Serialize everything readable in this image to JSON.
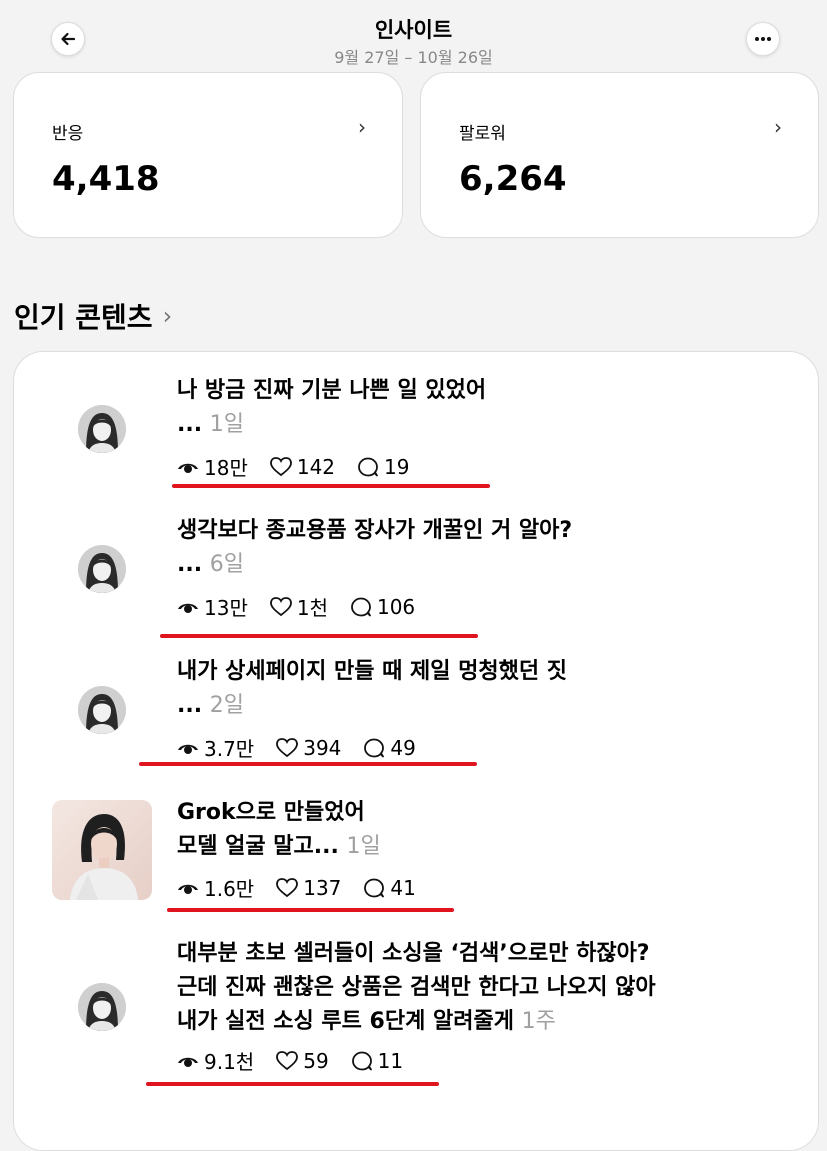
{
  "header": {
    "title": "인사이트",
    "date_range": "9월 27일 – 10월 26일"
  },
  "stats": [
    {
      "label": "반응",
      "value": "4,418"
    },
    {
      "label": "팔로워",
      "value": "6,264"
    }
  ],
  "section": {
    "title": "인기 콘텐츠",
    "chevron": "›"
  },
  "posts": [
    {
      "lines": [
        "나 방금 진짜 기분 나쁜 일 있었어",
        "..."
      ],
      "ago": "1일",
      "views": "18만",
      "likes": "142",
      "comments": "19"
    },
    {
      "lines": [
        "생각보다 종교용품 장사가 개꿀인 거 알아?",
        "..."
      ],
      "ago": "6일",
      "views": "13만",
      "likes": "1천",
      "comments": "106"
    },
    {
      "lines": [
        "내가 상세페이지 만들 때 제일 멍청했던 짓",
        "..."
      ],
      "ago": "2일",
      "views": "3.7만",
      "likes": "394",
      "comments": "49"
    },
    {
      "lines": [
        "Grok으로 만들었어",
        "모델 얼굴 말고..."
      ],
      "ago": "1일",
      "views": "1.6만",
      "likes": "137",
      "comments": "41"
    },
    {
      "lines": [
        "대부분 초보 셀러들이 소싱을 ‘검색’으로만 하잖아?",
        "근데 진짜 괜찮은 상품은 검색만 한다고 나오지 않아",
        "내가 실전 소싱 루트 6단계 알려줄게"
      ],
      "ago": "1주",
      "views": "9.1천",
      "likes": "59",
      "comments": "11"
    }
  ],
  "colors": {
    "accent_underline": "#e0141e",
    "muted": "#a0a0a0"
  },
  "icons": {
    "back": "arrow-left-icon",
    "more": "more-horizontal-icon",
    "views": "eye-icon",
    "likes": "heart-icon",
    "comments": "comment-icon"
  }
}
